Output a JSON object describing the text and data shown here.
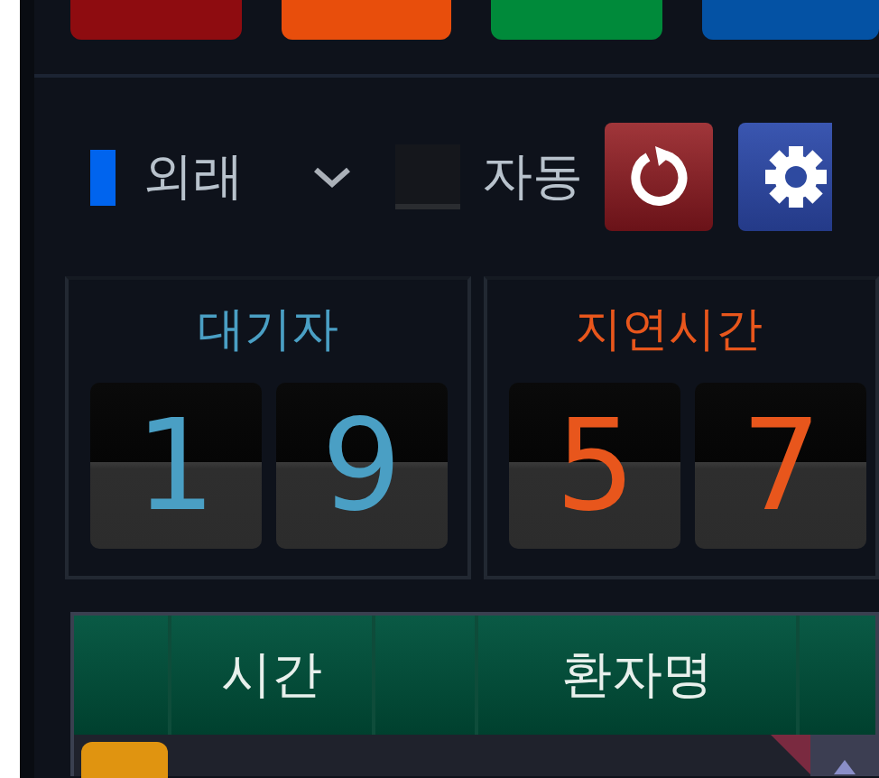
{
  "top_buttons": [
    {
      "color": "#8e0c10"
    },
    {
      "color": "#e84e0c"
    },
    {
      "color": "#008a3a"
    },
    {
      "color": "#0452a4"
    }
  ],
  "filter": {
    "label": "외래"
  },
  "auto": {
    "label": "자동",
    "checked": false
  },
  "counters": [
    {
      "title": "대기자",
      "color": "#4a9fc4",
      "digits": [
        "1",
        "9"
      ]
    },
    {
      "title": "지연시간",
      "color": "#e8561c",
      "digits": [
        "5",
        "7"
      ]
    }
  ],
  "table": {
    "columns": [
      {
        "label": "시간"
      },
      {
        "label": "환자명"
      }
    ]
  }
}
